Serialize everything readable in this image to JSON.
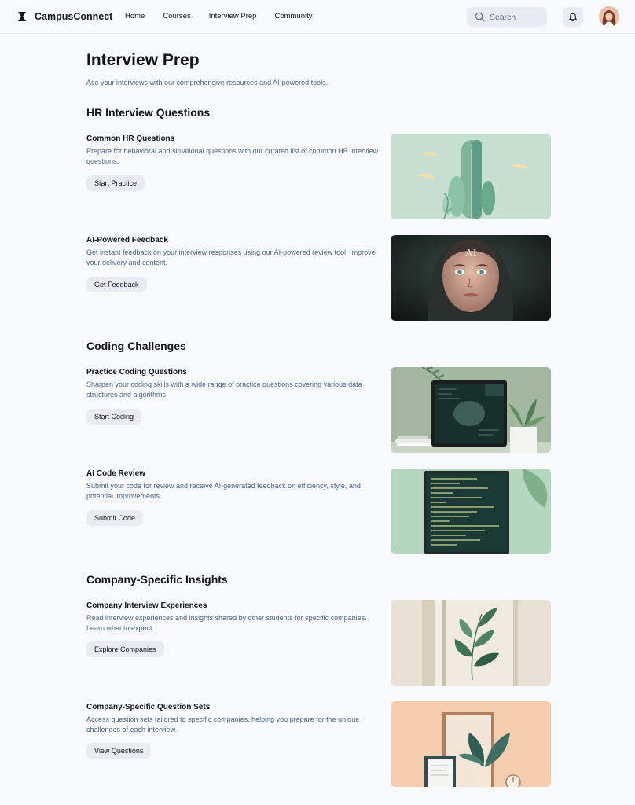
{
  "header": {
    "brand": "CampusConnect",
    "nav": [
      "Home",
      "Courses",
      "Interview Prep",
      "Community"
    ],
    "search_placeholder": "Search"
  },
  "page": {
    "title": "Interview Prep",
    "subtitle": "Ace your interviews with our comprehensive resources and AI-powered tools."
  },
  "sections": [
    {
      "title": "HR Interview Questions",
      "cards": [
        {
          "title": "Common HR Questions",
          "description": "Prepare for behavioral and situational questions with our curated list of common HR interview questions.",
          "button": "Start Practice",
          "image": "stylized-trees-illustration"
        },
        {
          "title": "AI-Powered Feedback",
          "description": "Get instant feedback on your interview responses using our AI-powered review tool. Improve your delivery and content.",
          "button": "Get Feedback",
          "image": "ai-face-portrait",
          "image_text": "AI"
        }
      ]
    },
    {
      "title": "Coding Challenges",
      "cards": [
        {
          "title": "Practice Coding Questions",
          "description": "Sharpen your coding skills with a wide range of practice questions covering various data structures and algorithms.",
          "button": "Start Coding",
          "image": "monitor-with-plant"
        },
        {
          "title": "AI Code Review",
          "description": "Submit your code for review and receive AI-generated feedback on efficiency, style, and potential improvements.",
          "button": "Submit Code",
          "image": "code-screen"
        }
      ]
    },
    {
      "title": "Company-Specific Insights",
      "cards": [
        {
          "title": "Company Interview Experiences",
          "description": "Read interview experiences and insights shared by other students for specific companies. Learn what to expect.",
          "button": "Explore Companies",
          "image": "framed-leaf-art"
        },
        {
          "title": "Company-Specific Question Sets",
          "description": "Access question sets tailored to specific companies, helping you prepare for the unique challenges of each interview.",
          "button": "View Questions",
          "image": "desk-with-plant-peach"
        }
      ]
    }
  ],
  "colors": {
    "background": "#f7f9fc",
    "button_bg": "#e8ecf2",
    "muted_text": "#4a6583"
  },
  "icons": [
    "brand-icon",
    "search-icon",
    "bell-icon",
    "avatar"
  ]
}
